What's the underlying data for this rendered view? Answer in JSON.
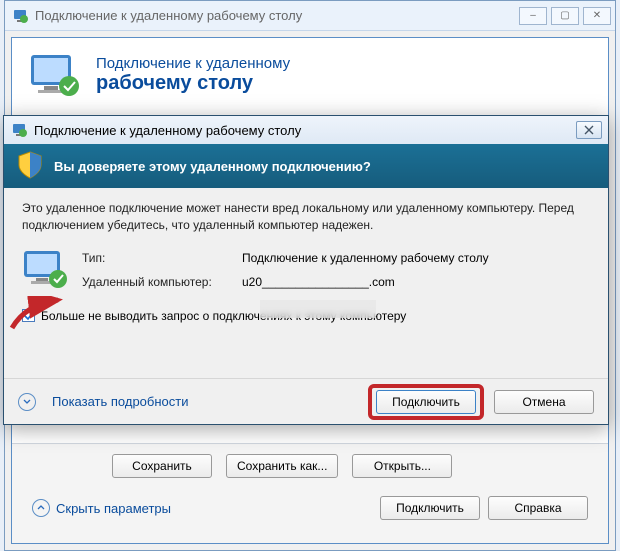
{
  "back": {
    "title": "Подключение к удаленному рабочему столу",
    "header_line1": "Подключение к удаленному",
    "header_line2": "рабочему столу",
    "btn_save": "Сохранить",
    "btn_save_as": "Сохранить как...",
    "btn_open": "Открыть...",
    "hide_params": "Скрыть параметры",
    "btn_connect": "Подключить",
    "btn_help": "Справка"
  },
  "dialog": {
    "title": "Подключение к удаленному рабочему столу",
    "banner": "Вы доверяете этому удаленному подключению?",
    "message": "Это удаленное подключение может нанести вред локальному или удаленному компьютеру. Перед подключением убедитесь, что удаленный компьютер надежен.",
    "field_type_label": "Тип:",
    "field_type_value": "Подключение к удаленному рабочему столу",
    "field_host_label": "Удаленный компьютер:",
    "field_host_value": "u20________________.com",
    "checkbox_label": "Больше не выводить запрос о подключениях к этому компьютеру",
    "checkbox_checked": true,
    "show_details": "Показать подробности",
    "btn_connect": "Подключить",
    "btn_cancel": "Отмена"
  },
  "colors": {
    "accent": "#0a4c9c",
    "banner": "#1b7096",
    "highlight": "#c3272a"
  }
}
